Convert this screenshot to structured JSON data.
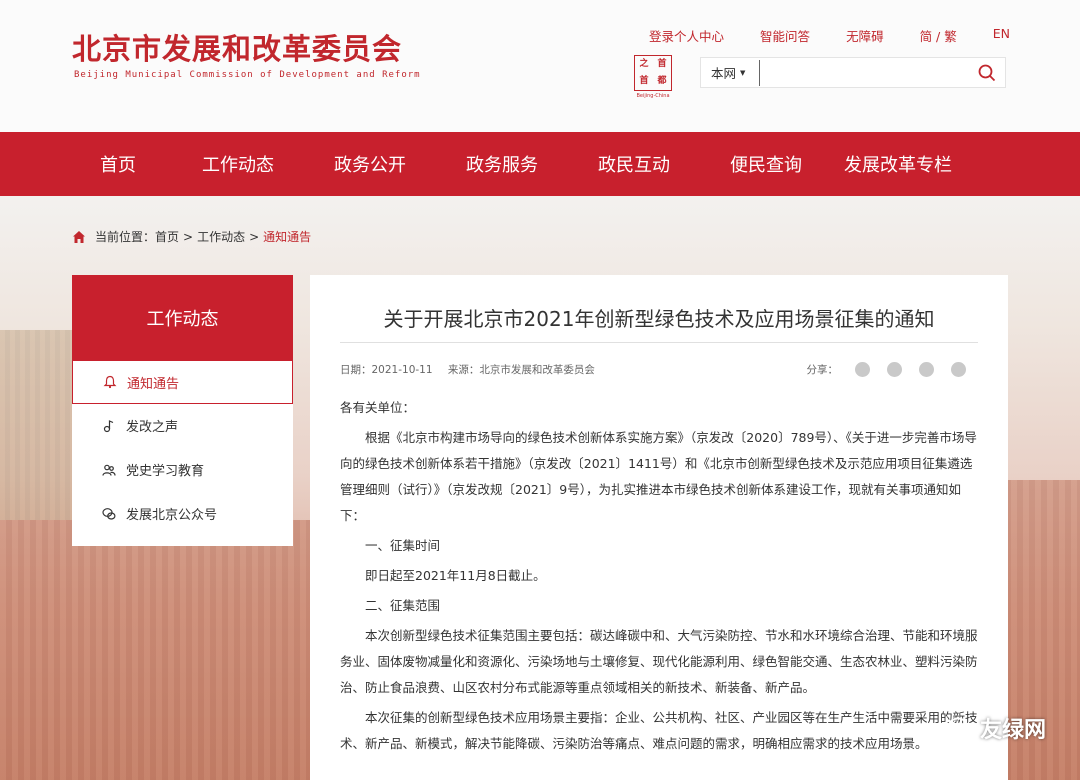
{
  "header": {
    "org_name_cn": "北京市发展和改革委员会",
    "org_name_en": "Beijing Municipal Commission of Development and Reform",
    "top_links": [
      "登录个人中心",
      "智能问答",
      "无障碍",
      "简 / 繁",
      "EN"
    ],
    "seal_chars": [
      "之",
      "首",
      "首",
      "都"
    ],
    "seal_caption": "Beijing-China",
    "search": {
      "scope": "本网",
      "value": ""
    }
  },
  "nav": [
    "首页",
    "工作动态",
    "政务公开",
    "政务服务",
    "政民互动",
    "便民查询",
    "发展改革专栏"
  ],
  "breadcrumb": {
    "label": "当前位置：",
    "items": [
      "首页",
      "工作动态",
      "通知通告"
    ]
  },
  "sidebar": {
    "title": "工作动态",
    "items": [
      {
        "label": "通知通告",
        "icon": "bell-icon",
        "active": true
      },
      {
        "label": "发改之声",
        "icon": "music-note-icon",
        "active": false
      },
      {
        "label": "党史学习教育",
        "icon": "people-icon",
        "active": false
      },
      {
        "label": "发展北京公众号",
        "icon": "wechat-icon",
        "active": false
      }
    ]
  },
  "article": {
    "title": "关于开展北京市2021年创新型绿色技术及应用场景征集的通知",
    "date": "日期：2021-10-11",
    "source": "来源：北京市发展和改革委员会",
    "share_label": "分享：",
    "salutation": "各有关单位：",
    "para1": "根据《北京市构建市场导向的绿色技术创新体系实施方案》（京发改〔2020〕789号）、《关于进一步完善市场导向的绿色技术创新体系若干措施》（京发改〔2021〕1411号）和《北京市创新型绿色技术及示范应用项目征集遴选管理细则（试行）》（京发改规〔2021〕9号），为扎实推进本市绿色技术创新体系建设工作，现就有关事项通知如下：",
    "sec1": "一、征集时间",
    "sec1_text": "即日起至2021年11月8日截止。",
    "sec2": "二、征集范围",
    "para2": "本次创新型绿色技术征集范围主要包括：碳达峰碳中和、大气污染防控、节水和水环境综合治理、节能和环境服务业、固体废物减量化和资源化、污染场地与土壤修复、现代化能源利用、绿色智能交通、生态农林业、塑料污染防治、防止食品浪费、山区农村分布式能源等重点领域相关的新技术、新装备、新产品。",
    "para3": "本次征集的创新型绿色技术应用场景主要指：企业、公共机构、社区、产业园区等在生产生活中需要采用的新技术、新产品、新模式，解决节能降碳、污染防治等痛点、难点问题的需求，明确相应需求的技术应用场景。"
  },
  "watermark": "友绿网",
  "colors": {
    "brand_red": "#c8202d"
  }
}
